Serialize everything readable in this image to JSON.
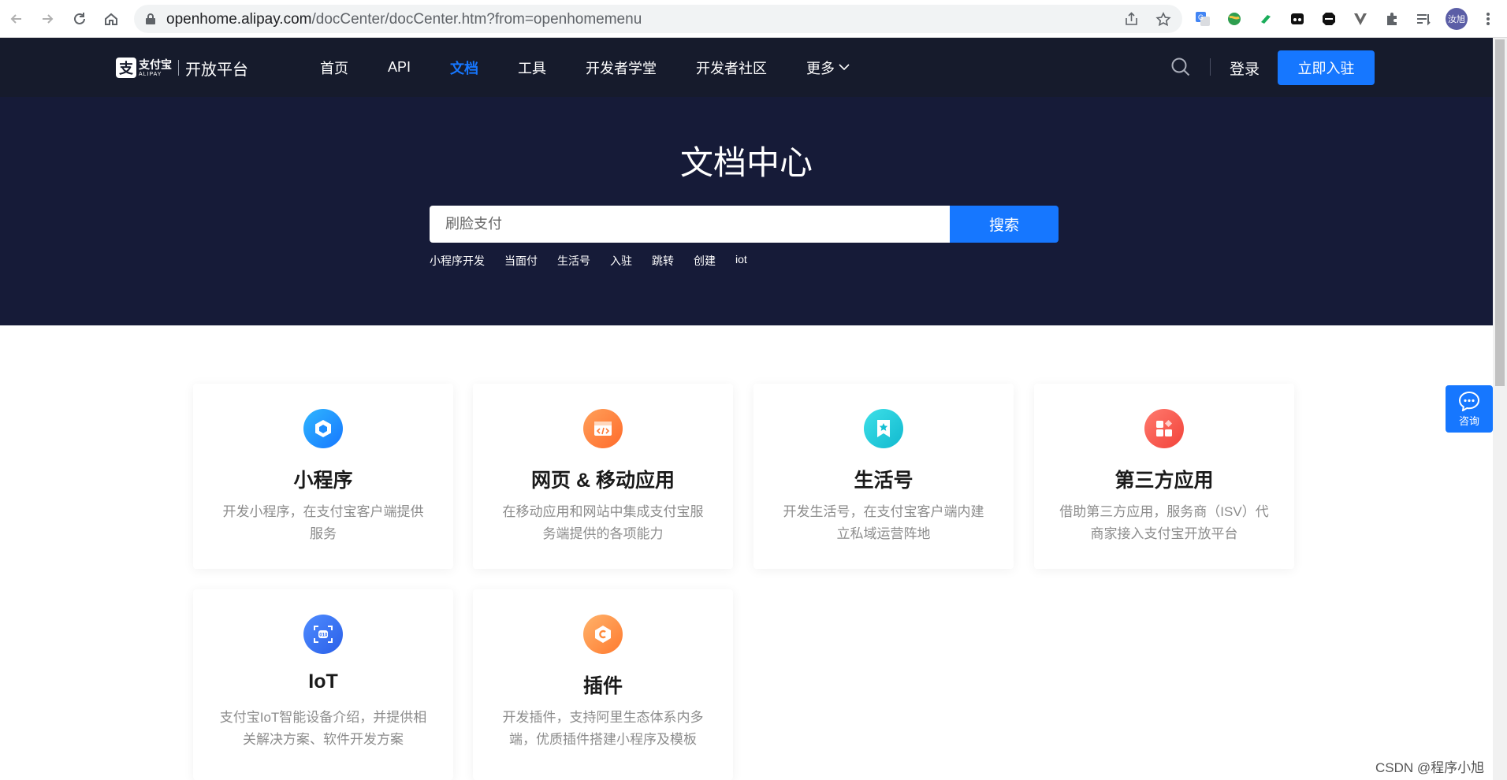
{
  "browser": {
    "url_host": "openhome.alipay.com",
    "url_path": "/docCenter/docCenter.htm?from=openhomemenu",
    "profile_initials": "汝旭"
  },
  "header": {
    "logo_cn": "支付宝",
    "logo_en": "ALIPAY",
    "logo_sub": "开放平台",
    "nav": [
      "首页",
      "API",
      "文档",
      "工具",
      "开发者学堂",
      "开发者社区",
      "更多"
    ],
    "active_nav": "文档",
    "login": "登录",
    "signup": "立即入驻"
  },
  "hero": {
    "title": "文档中心",
    "search_placeholder": "刷脸支付",
    "search_button": "搜索",
    "hot_tags": [
      "小程序开发",
      "当面付",
      "生活号",
      "入驻",
      "跳转",
      "创建",
      "iot"
    ]
  },
  "cards": [
    {
      "title": "小程序",
      "desc": "开发小程序，在支付宝客户端提供服务",
      "icon": "mini-program-icon"
    },
    {
      "title": "网页 & 移动应用",
      "desc": "在移动应用和网站中集成支付宝服务端提供的各项能力",
      "icon": "code-window-icon"
    },
    {
      "title": "生活号",
      "desc": "开发生活号，在支付宝客户端内建立私域运营阵地",
      "icon": "bookmark-star-icon"
    },
    {
      "title": "第三方应用",
      "desc": "借助第三方应用，服务商（ISV）代商家接入支付宝开放平台",
      "icon": "app-grid-icon"
    },
    {
      "title": "IoT",
      "desc": "支付宝IoT智能设备介绍，并提供相关解决方案、软件开发方案",
      "icon": "iot-scan-icon"
    },
    {
      "title": "插件",
      "desc": "开发插件，支持阿里生态体系内多端，优质插件搭建小程序及模板",
      "icon": "plugin-icon"
    }
  ],
  "consult": {
    "label": "咨询"
  },
  "watermark": "CSDN @程序小旭",
  "colors": {
    "primary": "#1677ff",
    "header_bg": "#161b2c",
    "hero_bg": "#161b38"
  }
}
